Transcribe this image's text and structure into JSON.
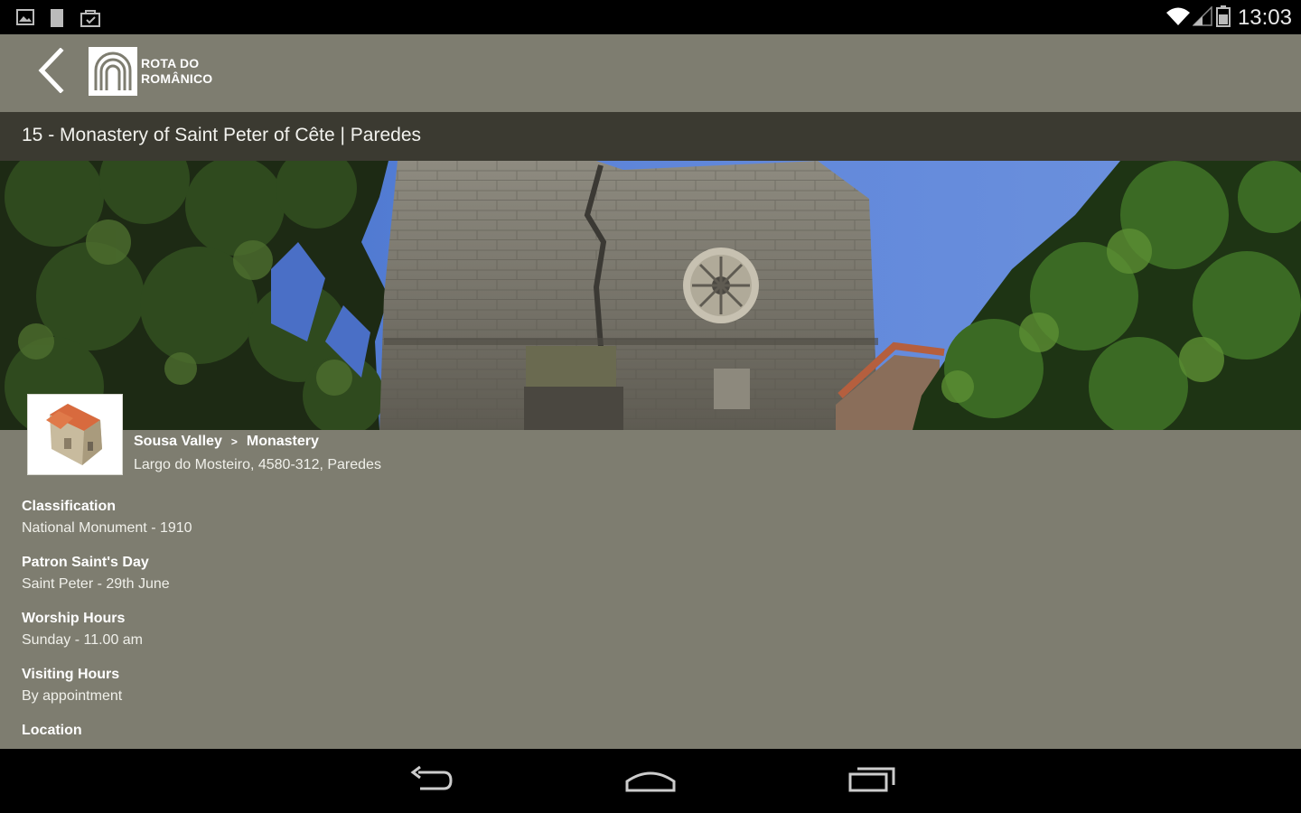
{
  "status_bar": {
    "time": "13:03",
    "icons": [
      "image-notification-icon",
      "sd-card-icon",
      "store-icon",
      "wifi-icon",
      "signal-icon",
      "battery-icon"
    ]
  },
  "app_bar": {
    "logo_line1": "ROTA DO",
    "logo_line2": "ROMÂNICO"
  },
  "title": "15 - Monastery of Saint Peter of Cête | Paredes",
  "breadcrumb": {
    "region": "Sousa Valley",
    "separator": ">",
    "type": "Monastery"
  },
  "address": "Largo do Mosteiro, 4580-312, Paredes",
  "details": [
    {
      "label": "Classification",
      "value": "National Monument - 1910"
    },
    {
      "label": "Patron Saint's Day",
      "value": "Saint Peter - 29th June"
    },
    {
      "label": "Worship Hours",
      "value": "Sunday - 11.00 am"
    },
    {
      "label": "Visiting Hours",
      "value": "By appointment"
    },
    {
      "label": "Location",
      "value": ""
    }
  ],
  "colors": {
    "app_bar": "#7e7d70",
    "title_bar": "#3b3a31",
    "content_bg": "#7e7d70"
  }
}
